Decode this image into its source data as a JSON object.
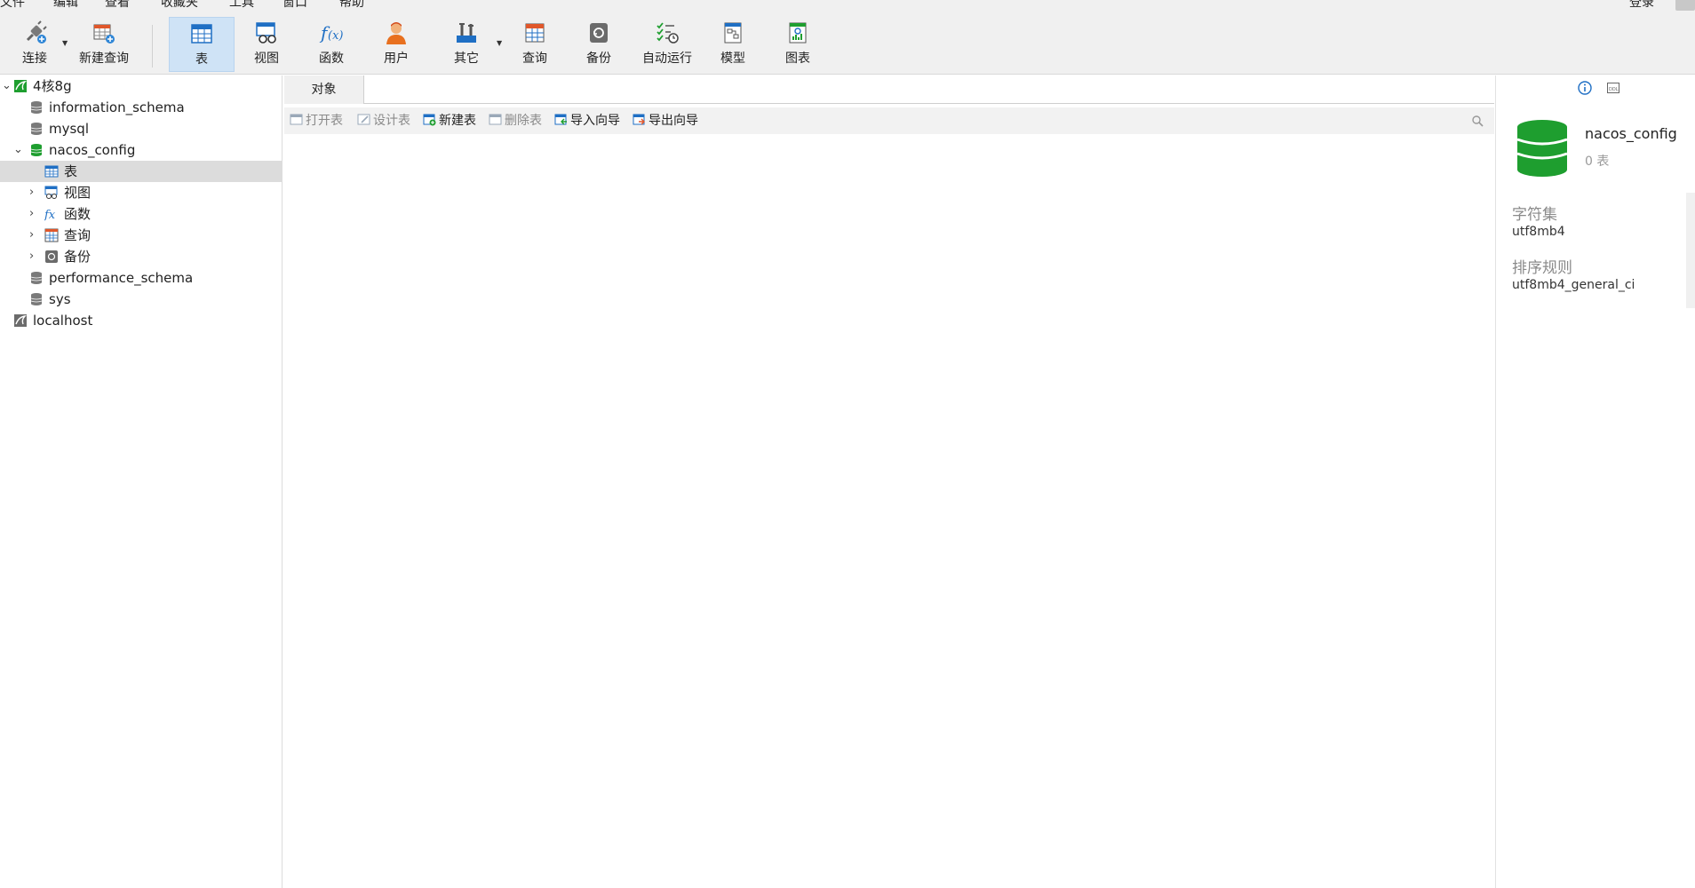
{
  "menu": {
    "items": [
      "文件",
      "编辑",
      "查看",
      "收藏夹",
      "工具",
      "窗口",
      "帮助"
    ],
    "login": "登录"
  },
  "toolbar": {
    "connect": "连接",
    "new_query": "新建查询",
    "table": "表",
    "view": "视图",
    "function": "函数",
    "user": "用户",
    "other": "其它",
    "query": "查询",
    "backup": "备份",
    "auto_run": "自动运行",
    "model": "模型",
    "chart": "图表"
  },
  "tree": {
    "conn1": "4核8g",
    "db_info": "information_schema",
    "db_mysql": "mysql",
    "db_nacos": "nacos_config",
    "child_table": "表",
    "child_view": "视图",
    "child_function": "函数",
    "child_query": "查询",
    "child_backup": "备份",
    "db_perf": "performance_schema",
    "db_sys": "sys",
    "conn2": "localhost"
  },
  "center": {
    "tab": "对象",
    "open_table": "打开表",
    "design_table": "设计表",
    "new_table": "新建表",
    "delete_table": "删除表",
    "import_wizard": "导入向导",
    "export_wizard": "导出向导"
  },
  "info": {
    "name": "nacos_config",
    "count": "0 表",
    "charset_label": "字符集",
    "charset_value": "utf8mb4",
    "collation_label": "排序规则",
    "collation_value": "utf8mb4_general_ci"
  },
  "colors": {
    "db_green": "#1e9e2f",
    "selected_tab": "#cfe3f6",
    "accent_blue": "#1f6fc4"
  }
}
